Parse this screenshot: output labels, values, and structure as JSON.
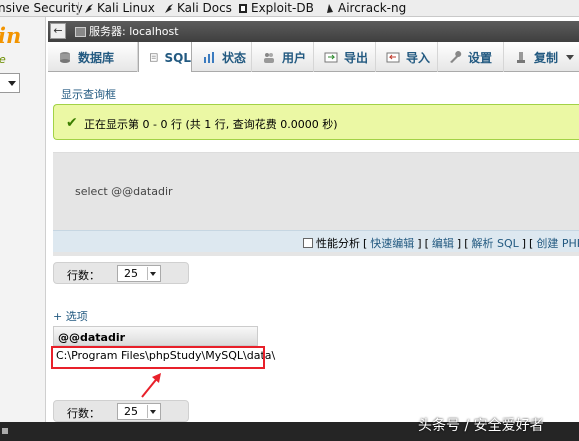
{
  "bookmarks": [
    {
      "label": "nsive Security"
    },
    {
      "label": "Kali Linux"
    },
    {
      "label": "Kali Docs"
    },
    {
      "label": "Exploit-DB"
    },
    {
      "label": "Aircrack-ng"
    }
  ],
  "breadcrumb": {
    "server_label": "服务器: localhost"
  },
  "tabs": [
    {
      "label": "数据库"
    },
    {
      "label": "SQL"
    },
    {
      "label": "状态"
    },
    {
      "label": "用户"
    },
    {
      "label": "导出"
    },
    {
      "label": "导入"
    },
    {
      "label": "设置"
    },
    {
      "label": "复制"
    }
  ],
  "main": {
    "show_query_box": "显示查询框",
    "success_message": "正在显示第 0 - 0 行 (共 1 行, 查询花费 0.0000 秒)",
    "sql_text": "select @@datadir",
    "sql_links": {
      "profiling": "性能分析",
      "inline_edit": "快速编辑",
      "edit": "编辑",
      "explain": "解析 SQL",
      "create_php": "创建 PHP 代码"
    },
    "rows_label": "行数：",
    "rows_value": "25",
    "options_link": "+ 选项",
    "result": {
      "column": "@@datadir",
      "value": "C:\\Program Files\\phpStudy\\MySQL\\data\\"
    }
  },
  "watermark": "头条号 / 安全爱好者",
  "colors": {
    "accent_link": "#235a81",
    "success_bg": "#ebf8a4",
    "highlight": "#e8202a",
    "logo": "#f29400"
  }
}
